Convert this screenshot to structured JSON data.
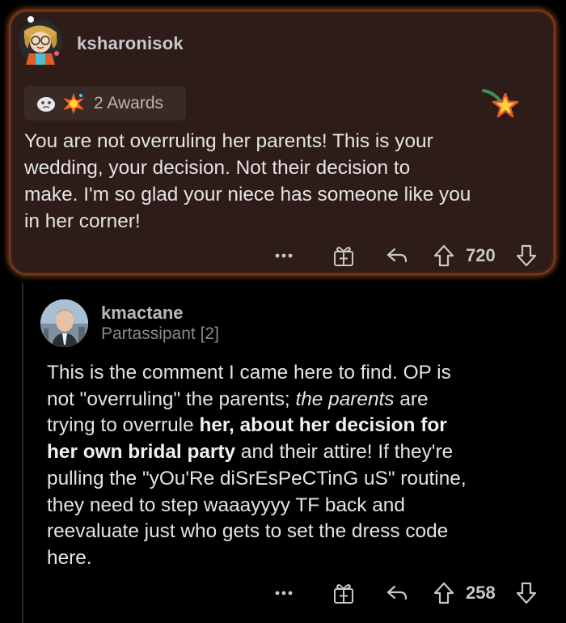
{
  "comment1": {
    "author": "ksharonisok",
    "awards_label": "2 Awards",
    "body_lines": [
      "You are not overruling her parents!  This is your",
      "wedding, your decision.  Not their decision to",
      "make.  I'm so glad your niece has someone like you",
      "in her corner!"
    ],
    "more": "•••",
    "score": "720"
  },
  "comment2": {
    "author": "kmactane",
    "flair": "Partassipant [2]",
    "body": {
      "l1": "This is the comment I came here to find. OP is",
      "l2a": "not \"overruling\" the parents; ",
      "l2b": "the parents",
      "l2c": " are",
      "l3a": "trying to overrule ",
      "l3b": "her, about her decision for",
      "l4a": "her own bridal party",
      "l4b": " and their attire! If they're",
      "l5": "pulling the \"yOu'Re diSrEsPeCTinG uS\" routine,",
      "l6": "they need to step waaayyyy TF back and",
      "l7": "reevaluate just who gets to set the dress code",
      "l8": "here."
    },
    "more": "•••",
    "score": "258"
  },
  "icons": {
    "gift": "gift-icon",
    "reply": "reply-icon",
    "upvote": "upvote-icon",
    "downvote": "downvote-icon",
    "more": "more-icon",
    "star_badge": "star-badge-icon"
  },
  "colors": {
    "highlight_border": "#7a3a1e",
    "highlight_bg": "#2d1c17",
    "text": "#e4e4e6",
    "muted": "#8a8a8d"
  }
}
